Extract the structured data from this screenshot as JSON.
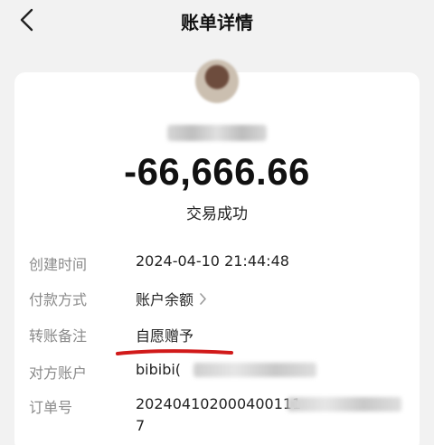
{
  "header": {
    "title": "账单详情"
  },
  "transaction": {
    "amount": "-66,666.66",
    "status": "交易成功"
  },
  "details": {
    "created_time_label": "创建时间",
    "created_time_value": "2024-04-10 21:44:48",
    "payment_method_label": "付款方式",
    "payment_method_value": "账户余额",
    "remark_label": "转账备注",
    "remark_value": "自愿赠予",
    "counterparty_label": "对方账户",
    "counterparty_value": "bibibi(",
    "order_no_label": "订单号",
    "order_no_value_line1": "202404102000400111",
    "order_no_value_line2": "7"
  },
  "colors": {
    "annotation_underline": "#d11a1a",
    "background": "#f2f2f2",
    "card": "#ffffff"
  },
  "icons": {
    "back": "chevron-left-icon",
    "payment_method_arrow": "chevron-right-icon"
  }
}
